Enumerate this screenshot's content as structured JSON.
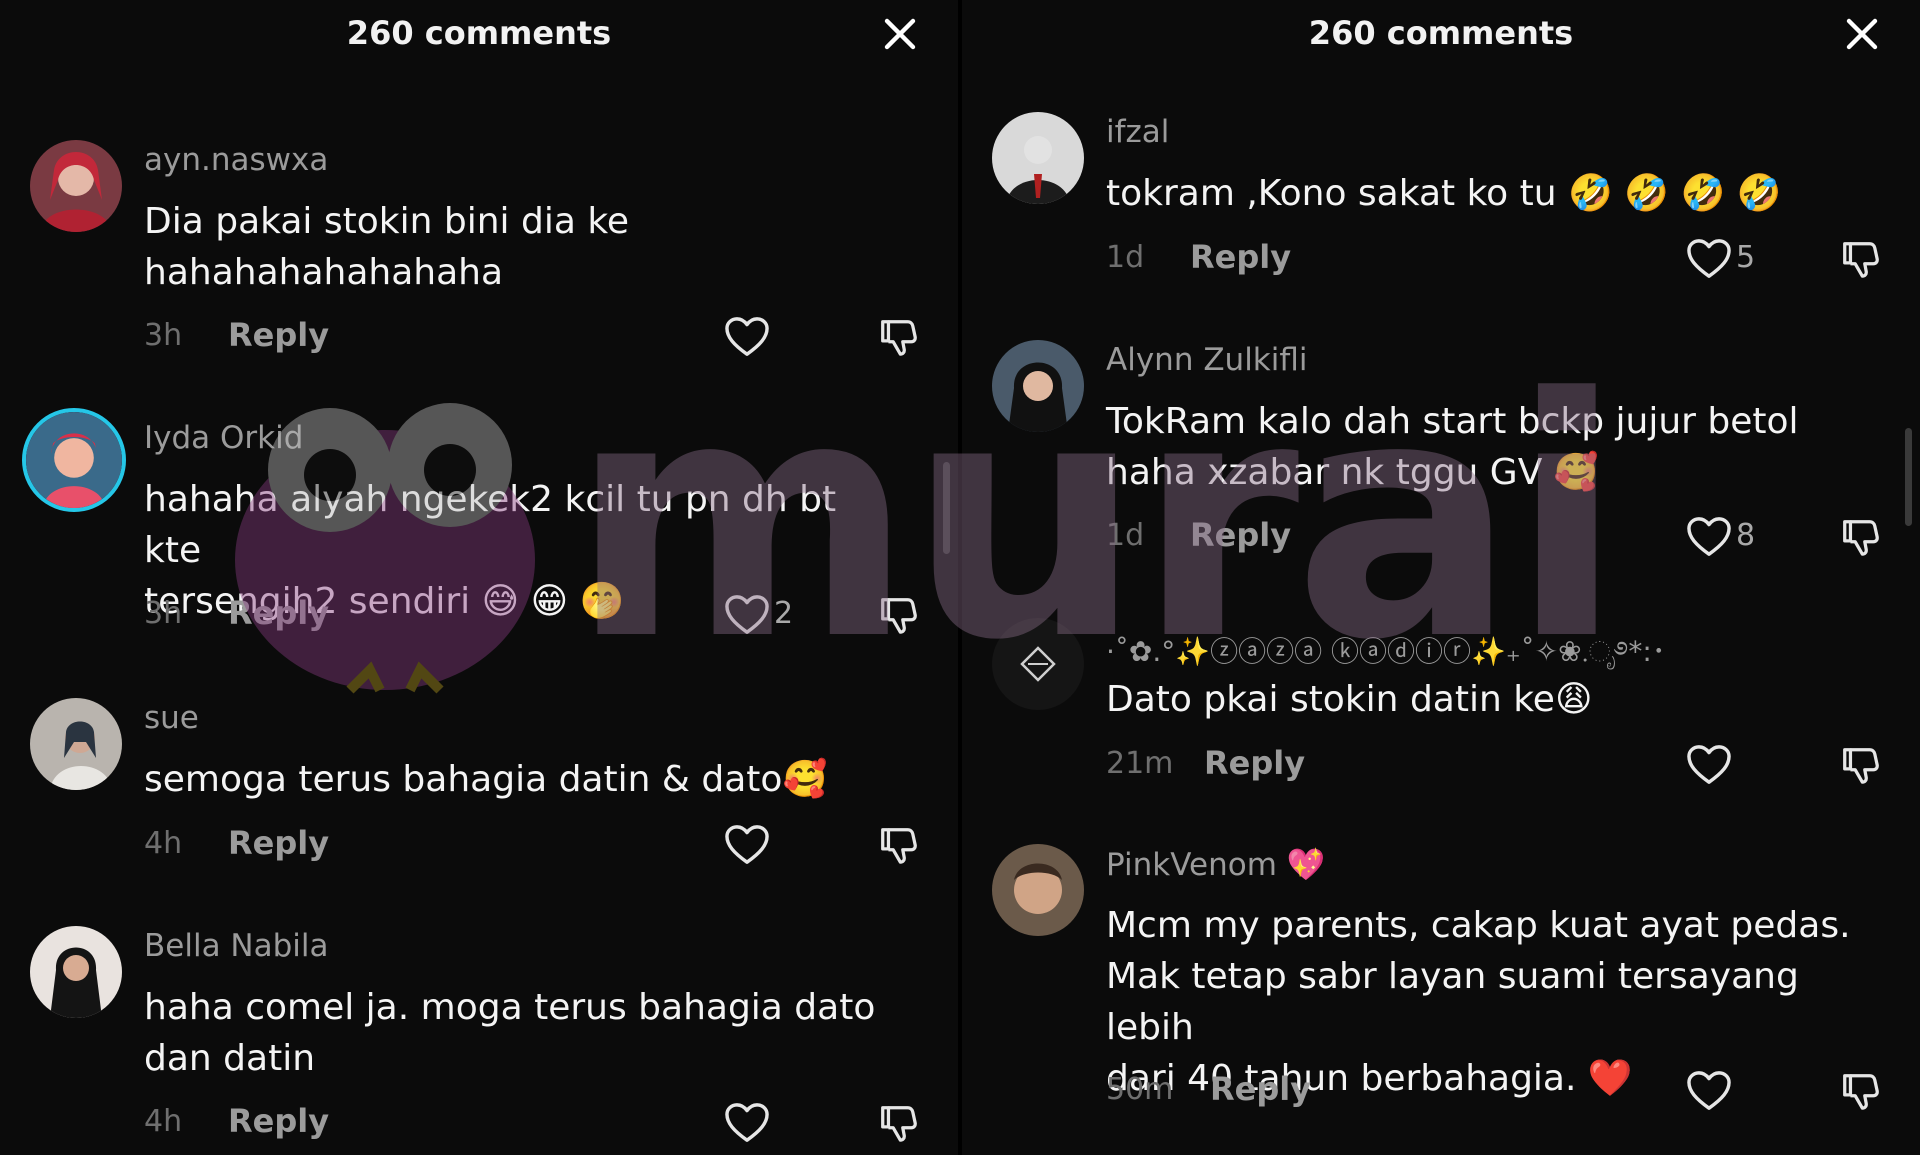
{
  "left_panel": {
    "title": "260 comments",
    "comments": [
      {
        "username": "ayn.naswxa",
        "text_lines": [
          "Dia pakai stokin bini dia ke",
          "hahahahahahahaha"
        ],
        "time": "3h",
        "reply": "Reply",
        "likes": ""
      },
      {
        "username": "Iyda Orkid",
        "text_lines": [
          "hahaha alyah ngekek2 kcil tu pn dh bt kte",
          "tersengih2 sendiri 😅 😁 🤭"
        ],
        "time": "3h",
        "reply": "Reply",
        "likes": "2"
      },
      {
        "username": "sue",
        "text_lines": [
          "semoga terus bahagia datin & dato🥰"
        ],
        "time": "4h",
        "reply": "Reply",
        "likes": ""
      },
      {
        "username": "Bella Nabila",
        "text_lines": [
          "haha comel ja. moga terus bahagia dato",
          "dan datin"
        ],
        "time": "4h",
        "reply": "Reply",
        "likes": ""
      }
    ]
  },
  "right_panel": {
    "title": "260 comments",
    "comments": [
      {
        "username": "ifzal",
        "text_lines": [
          "tokram ,Kono sakat ko tu 🤣 🤣 🤣 🤣"
        ],
        "time": "1d",
        "reply": "Reply",
        "likes": "5"
      },
      {
        "username": "Alynn Zulkifli",
        "text_lines": [
          "TokRam kalo dah start bckp jujur betol",
          "haha xzabar nk tggu GV 🥰"
        ],
        "time": "1d",
        "reply": "Reply",
        "likes": "8"
      },
      {
        "username": "·˚✿.°✨ⓩⓐⓩⓐ ⓚⓐⓓⓘⓡ✨₊˚✧❀.ೃ࿔*:･",
        "text_lines": [
          "Dato pkai stokin datin ke😩"
        ],
        "time": "21m",
        "reply": "Reply",
        "likes": ""
      },
      {
        "username": "PinkVenom 💖",
        "text_lines": [
          "Mcm my parents, cakap kuat ayat pedas.",
          "Mak tetap sabr layan suami tersayang lebih",
          "dari 40 tahun berbahagia. ❤️"
        ],
        "time": "50m",
        "reply": "Reply",
        "likes": ""
      }
    ]
  },
  "watermark": {
    "text": "murai"
  },
  "icons": {
    "close": "close-icon",
    "like": "heart-icon",
    "dislike": "thumbs-down-icon"
  },
  "colors": {
    "background": "#0b0b0b",
    "ring": "#25c7e8",
    "muted": "#9b9b9b"
  }
}
